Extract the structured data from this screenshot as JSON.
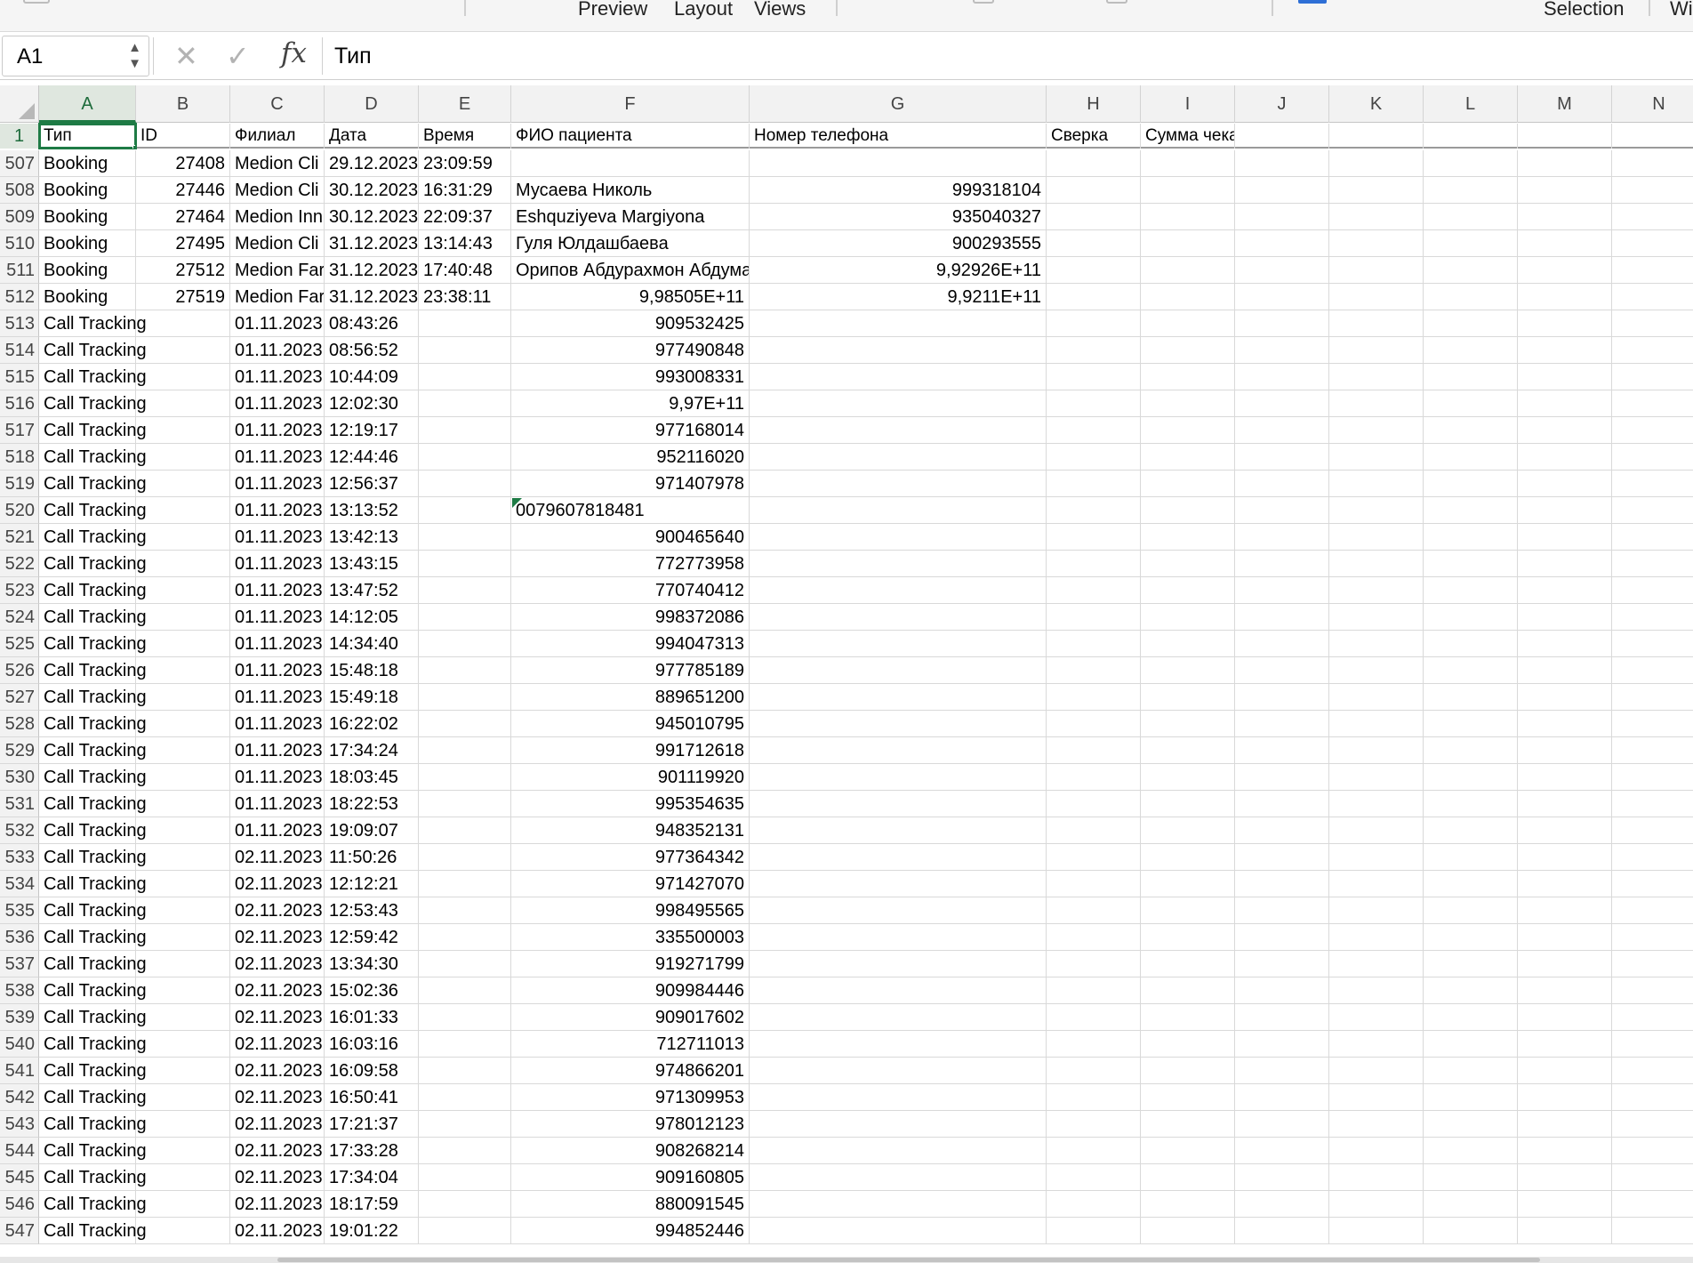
{
  "ribbon": {
    "preview_label": "Preview",
    "layout_label": "Layout",
    "views_label": "Views",
    "selection_label": "Selection",
    "cut_label": "Wi"
  },
  "formula_bar": {
    "name_box": "A1",
    "cancel_icon": "x-icon",
    "enter_icon": "check-icon",
    "fx_label": "fx",
    "content": "Тип"
  },
  "columns": [
    "A",
    "B",
    "C",
    "D",
    "E",
    "F",
    "G",
    "H",
    "I",
    "J",
    "K",
    "L",
    "M",
    "N"
  ],
  "header_row": {
    "number": "1",
    "cells": [
      "Тип",
      "ID",
      "Филиал",
      "Дата",
      "Время",
      "ФИО пациента",
      "Номер телефона",
      "Сверка",
      "Сумма чека"
    ]
  },
  "rows": [
    {
      "n": "507",
      "a": "Booking",
      "b": "27408",
      "c": "Medion Cli",
      "d": "29.12.2023",
      "e": "23:09:59",
      "f": "",
      "g": ""
    },
    {
      "n": "508",
      "a": "Booking",
      "b": "27446",
      "c": "Medion Cli",
      "d": "30.12.2023",
      "e": "16:31:29",
      "f": "Мусаева Николь",
      "g": "999318104"
    },
    {
      "n": "509",
      "a": "Booking",
      "b": "27464",
      "c": "Medion Inn",
      "d": "30.12.2023",
      "e": "22:09:37",
      "f": "Eshquziyeva Margiyona",
      "g": "935040327"
    },
    {
      "n": "510",
      "a": "Booking",
      "b": "27495",
      "c": "Medion Cli",
      "d": "31.12.2023",
      "e": "13:14:43",
      "f": "Гуля Юлдашбаева",
      "g": "900293555"
    },
    {
      "n": "511",
      "a": "Booking",
      "b": "27512",
      "c": "Medion Far",
      "d": "31.12.2023",
      "e": "17:40:48",
      "f": "Орипов Абдурахмон Абдумал",
      "g": "9,92926E+11"
    },
    {
      "n": "512",
      "a": "Booking",
      "b": "27519",
      "c": "Medion Far",
      "d": "31.12.2023",
      "e": "23:38:11",
      "f": "9,98505E+11",
      "g": "9,9211E+11"
    },
    {
      "n": "513",
      "a": "Call Tracking",
      "c": "01.11.2023",
      "d": "08:43:26",
      "f": "909532425"
    },
    {
      "n": "514",
      "a": "Call Tracking",
      "c": "01.11.2023",
      "d": "08:56:52",
      "f": "977490848"
    },
    {
      "n": "515",
      "a": "Call Tracking",
      "c": "01.11.2023",
      "d": "10:44:09",
      "f": "993008331"
    },
    {
      "n": "516",
      "a": "Call Tracking",
      "c": "01.11.2023",
      "d": "12:02:30",
      "f": "9,97E+11"
    },
    {
      "n": "517",
      "a": "Call Tracking",
      "c": "01.11.2023",
      "d": "12:19:17",
      "f": "977168014"
    },
    {
      "n": "518",
      "a": "Call Tracking",
      "c": "01.11.2023",
      "d": "12:44:46",
      "f": "952116020"
    },
    {
      "n": "519",
      "a": "Call Tracking",
      "c": "01.11.2023",
      "d": "12:56:37",
      "f": "971407978"
    },
    {
      "n": "520",
      "a": "Call Tracking",
      "c": "01.11.2023",
      "d": "13:13:52",
      "f": "0079607818481",
      "f_text": true
    },
    {
      "n": "521",
      "a": "Call Tracking",
      "c": "01.11.2023",
      "d": "13:42:13",
      "f": "900465640"
    },
    {
      "n": "522",
      "a": "Call Tracking",
      "c": "01.11.2023",
      "d": "13:43:15",
      "f": "772773958"
    },
    {
      "n": "523",
      "a": "Call Tracking",
      "c": "01.11.2023",
      "d": "13:47:52",
      "f": "770740412"
    },
    {
      "n": "524",
      "a": "Call Tracking",
      "c": "01.11.2023",
      "d": "14:12:05",
      "f": "998372086"
    },
    {
      "n": "525",
      "a": "Call Tracking",
      "c": "01.11.2023",
      "d": "14:34:40",
      "f": "994047313"
    },
    {
      "n": "526",
      "a": "Call Tracking",
      "c": "01.11.2023",
      "d": "15:48:18",
      "f": "977785189"
    },
    {
      "n": "527",
      "a": "Call Tracking",
      "c": "01.11.2023",
      "d": "15:49:18",
      "f": "889651200"
    },
    {
      "n": "528",
      "a": "Call Tracking",
      "c": "01.11.2023",
      "d": "16:22:02",
      "f": "945010795"
    },
    {
      "n": "529",
      "a": "Call Tracking",
      "c": "01.11.2023",
      "d": "17:34:24",
      "f": "991712618"
    },
    {
      "n": "530",
      "a": "Call Tracking",
      "c": "01.11.2023",
      "d": "18:03:45",
      "f": "901119920"
    },
    {
      "n": "531",
      "a": "Call Tracking",
      "c": "01.11.2023",
      "d": "18:22:53",
      "f": "995354635"
    },
    {
      "n": "532",
      "a": "Call Tracking",
      "c": "01.11.2023",
      "d": "19:09:07",
      "f": "948352131"
    },
    {
      "n": "533",
      "a": "Call Tracking",
      "c": "02.11.2023",
      "d": "11:50:26",
      "f": "977364342"
    },
    {
      "n": "534",
      "a": "Call Tracking",
      "c": "02.11.2023",
      "d": "12:12:21",
      "f": "971427070"
    },
    {
      "n": "535",
      "a": "Call Tracking",
      "c": "02.11.2023",
      "d": "12:53:43",
      "f": "998495565"
    },
    {
      "n": "536",
      "a": "Call Tracking",
      "c": "02.11.2023",
      "d": "12:59:42",
      "f": "335500003"
    },
    {
      "n": "537",
      "a": "Call Tracking",
      "c": "02.11.2023",
      "d": "13:34:30",
      "f": "919271799"
    },
    {
      "n": "538",
      "a": "Call Tracking",
      "c": "02.11.2023",
      "d": "15:02:36",
      "f": "909984446"
    },
    {
      "n": "539",
      "a": "Call Tracking",
      "c": "02.11.2023",
      "d": "16:01:33",
      "f": "909017602"
    },
    {
      "n": "540",
      "a": "Call Tracking",
      "c": "02.11.2023",
      "d": "16:03:16",
      "f": "712711013"
    },
    {
      "n": "541",
      "a": "Call Tracking",
      "c": "02.11.2023",
      "d": "16:09:58",
      "f": "974866201"
    },
    {
      "n": "542",
      "a": "Call Tracking",
      "c": "02.11.2023",
      "d": "16:50:41",
      "f": "971309953"
    },
    {
      "n": "543",
      "a": "Call Tracking",
      "c": "02.11.2023",
      "d": "17:21:37",
      "f": "978012123"
    },
    {
      "n": "544",
      "a": "Call Tracking",
      "c": "02.11.2023",
      "d": "17:33:28",
      "f": "908268214"
    },
    {
      "n": "545",
      "a": "Call Tracking",
      "c": "02.11.2023",
      "d": "17:34:04",
      "f": "909160805"
    },
    {
      "n": "546",
      "a": "Call Tracking",
      "c": "02.11.2023",
      "d": "18:17:59",
      "f": "880091545"
    },
    {
      "n": "547",
      "a": "Call Tracking",
      "c": "02.11.2023",
      "d": "19:01:22",
      "f": "994852446"
    }
  ]
}
